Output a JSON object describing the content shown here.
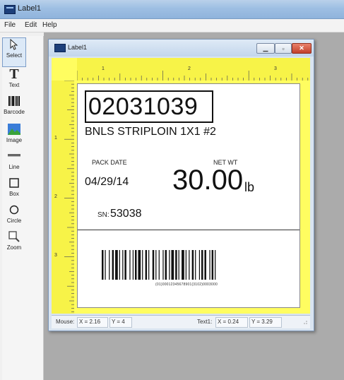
{
  "window": {
    "title": "Label1"
  },
  "menu": {
    "file": "File",
    "edit": "Edit",
    "help": "Help"
  },
  "tools": [
    {
      "label": "Select",
      "icon": "select-arrow-icon"
    },
    {
      "label": "Text",
      "icon": "text-tool-icon"
    },
    {
      "label": "Barcode",
      "icon": "barcode-tool-icon"
    },
    {
      "label": "Image",
      "icon": "image-tool-icon"
    },
    {
      "label": "Line",
      "icon": "line-tool-icon"
    },
    {
      "label": "Box",
      "icon": "box-tool-icon"
    },
    {
      "label": "Circle",
      "icon": "circle-tool-icon"
    },
    {
      "label": "Zoom",
      "icon": "zoom-tool-icon"
    }
  ],
  "document": {
    "title": "Label1",
    "ruler_numbers": [
      "1",
      "2",
      "3"
    ],
    "vruler_numbers": [
      "1",
      "2",
      "3"
    ]
  },
  "label": {
    "code": "02031039",
    "description": "BNLS STRIPLOIN 1X1 #2",
    "pack_date_label": "PACK DATE",
    "pack_date": "04/29/14",
    "net_wt_label": "NET WT",
    "net_wt": "30.00",
    "unit": "lb",
    "sn_label": "SN:",
    "sn": "53038",
    "barcode_text": "(01)00012345678901(3102)0003000"
  },
  "status": {
    "mouse_label": "Mouse:",
    "mouse_x": "X = 2.16",
    "mouse_y": "Y = 4",
    "text_label": "Text1:",
    "text_x": "X = 0.24",
    "text_y": "Y = 3.29"
  }
}
